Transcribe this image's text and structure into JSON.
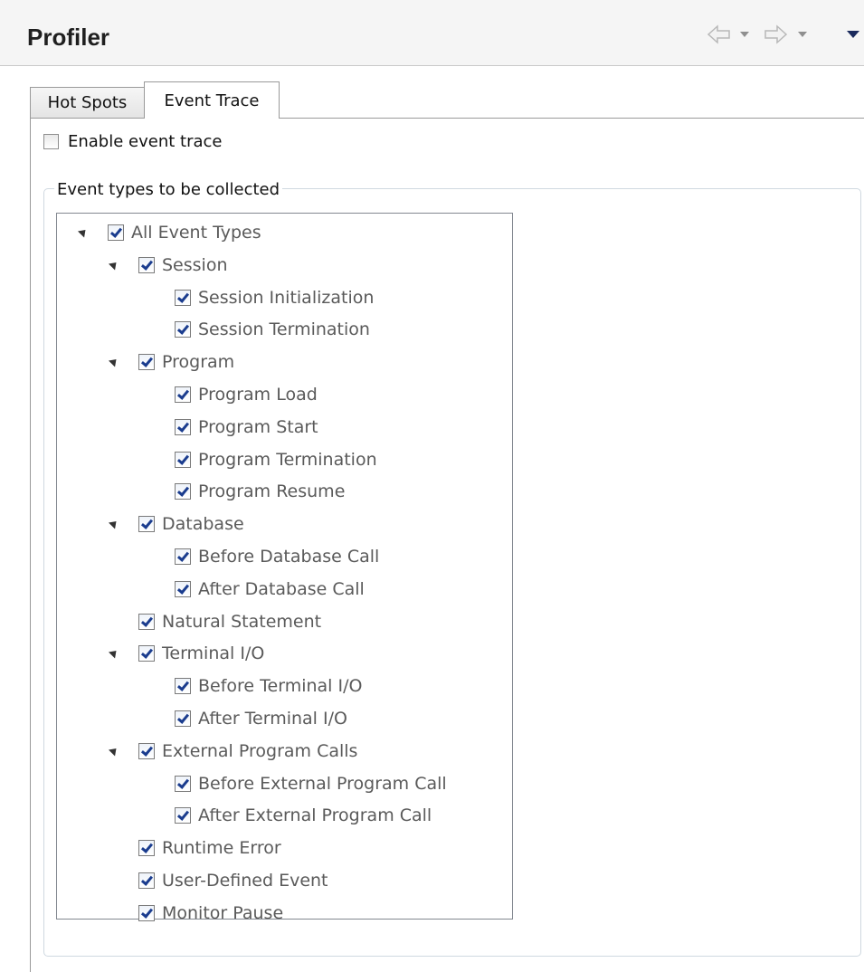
{
  "view": {
    "title": "Profiler",
    "nav": {
      "back_icon": "back-arrow-icon",
      "forward_icon": "forward-arrow-icon",
      "menu_icon": "view-menu-icon"
    }
  },
  "tabs": [
    {
      "label": "Hot Spots",
      "active": false
    },
    {
      "label": "Event Trace",
      "active": true
    }
  ],
  "enable": {
    "label": "Enable event trace",
    "checked": false
  },
  "group": {
    "legend": "Event types to be collected"
  },
  "tree": [
    {
      "label": "All Event Types",
      "level": 0,
      "expandable": true,
      "checked": true
    },
    {
      "label": "Session",
      "level": 1,
      "expandable": true,
      "checked": true
    },
    {
      "label": "Session Initialization",
      "level": 2,
      "expandable": false,
      "checked": true
    },
    {
      "label": "Session Termination",
      "level": 2,
      "expandable": false,
      "checked": true
    },
    {
      "label": "Program",
      "level": 1,
      "expandable": true,
      "checked": true
    },
    {
      "label": "Program Load",
      "level": 2,
      "expandable": false,
      "checked": true
    },
    {
      "label": "Program Start",
      "level": 2,
      "expandable": false,
      "checked": true
    },
    {
      "label": "Program Termination",
      "level": 2,
      "expandable": false,
      "checked": true
    },
    {
      "label": "Program Resume",
      "level": 2,
      "expandable": false,
      "checked": true
    },
    {
      "label": "Database",
      "level": 1,
      "expandable": true,
      "checked": true
    },
    {
      "label": "Before Database Call",
      "level": 2,
      "expandable": false,
      "checked": true
    },
    {
      "label": "After Database Call",
      "level": 2,
      "expandable": false,
      "checked": true
    },
    {
      "label": "Natural Statement",
      "level": 1,
      "expandable": false,
      "checked": true
    },
    {
      "label": "Terminal I/O",
      "level": 1,
      "expandable": true,
      "checked": true
    },
    {
      "label": "Before Terminal I/O",
      "level": 2,
      "expandable": false,
      "checked": true
    },
    {
      "label": "After Terminal I/O",
      "level": 2,
      "expandable": false,
      "checked": true
    },
    {
      "label": "External Program Calls",
      "level": 1,
      "expandable": true,
      "checked": true
    },
    {
      "label": "Before External Program Call",
      "level": 2,
      "expandable": false,
      "checked": true
    },
    {
      "label": "After External Program Call",
      "level": 2,
      "expandable": false,
      "checked": true
    },
    {
      "label": "Runtime Error",
      "level": 1,
      "expandable": false,
      "checked": true
    },
    {
      "label": "User-Defined Event",
      "level": 1,
      "expandable": false,
      "checked": true
    },
    {
      "label": "Monitor Pause",
      "level": 1,
      "expandable": false,
      "checked": true
    }
  ]
}
